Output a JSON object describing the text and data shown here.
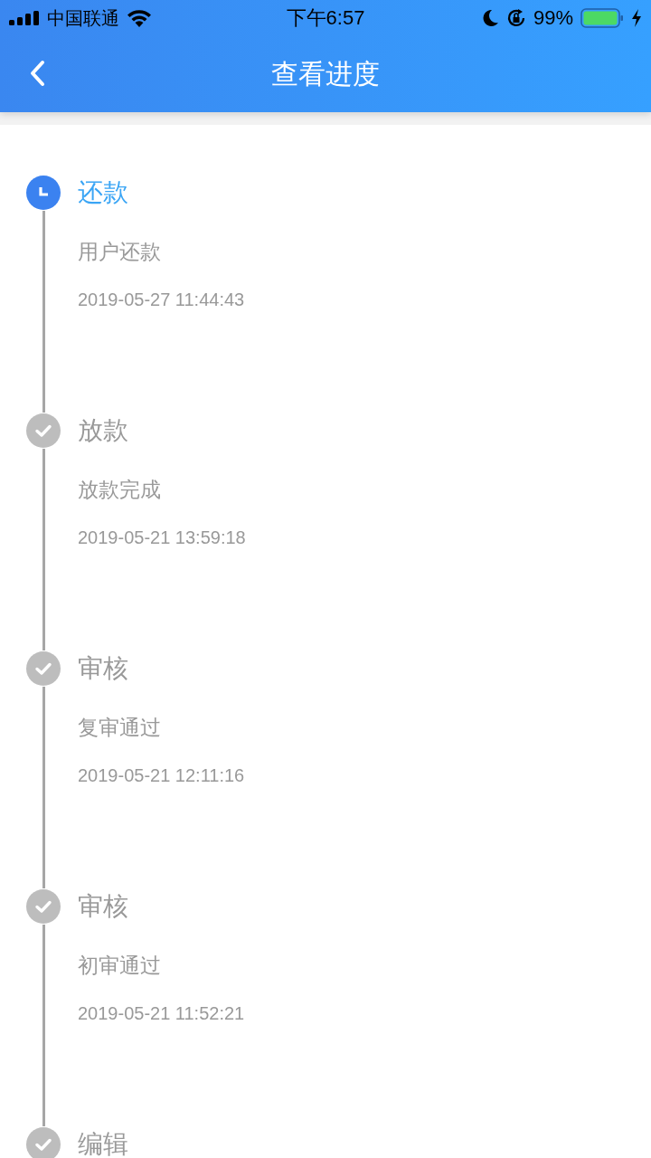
{
  "status_bar": {
    "carrier": "中国联通",
    "time": "下午6:57",
    "battery": "99%"
  },
  "nav": {
    "title": "查看进度"
  },
  "steps": [
    {
      "kind": "current",
      "title": "还款",
      "detail": "用户还款",
      "time": "2019-05-27 11:44:43"
    },
    {
      "kind": "done",
      "title": "放款",
      "detail": "放款完成",
      "time": "2019-05-21 13:59:18"
    },
    {
      "kind": "done",
      "title": "审核",
      "detail": "复审通过",
      "time": "2019-05-21 12:11:16"
    },
    {
      "kind": "done",
      "title": "审核",
      "detail": "初审通过",
      "time": "2019-05-21 11:52:21"
    },
    {
      "kind": "done",
      "title": "编辑"
    }
  ]
}
